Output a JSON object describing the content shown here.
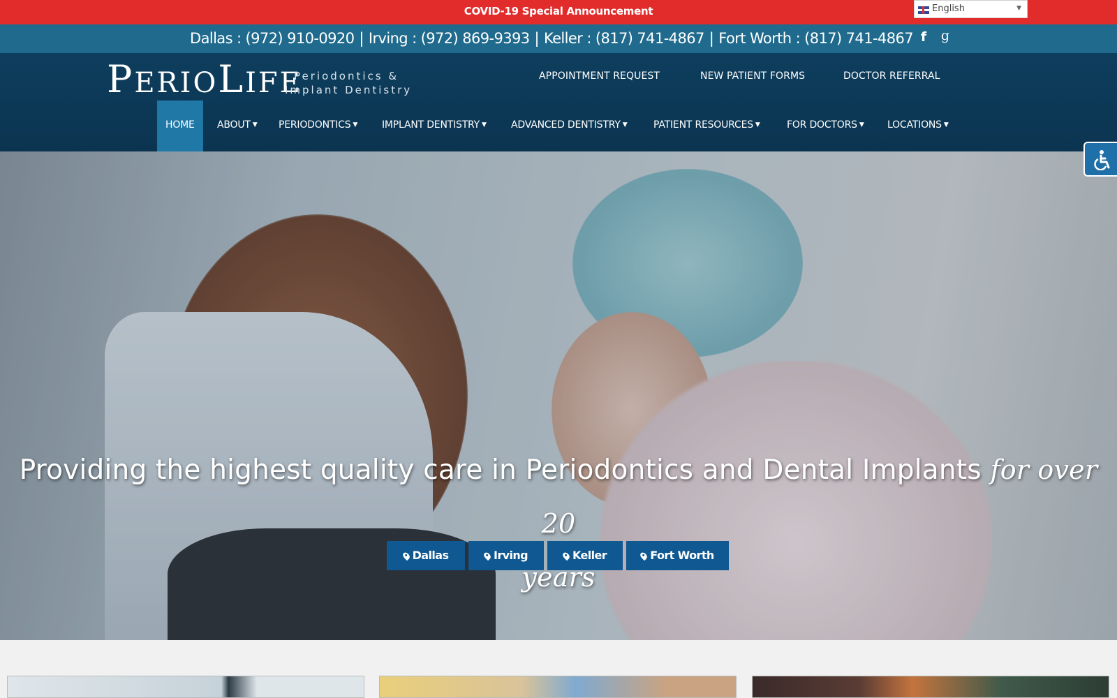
{
  "announcement": {
    "text": "COVID-19 Special Announcement"
  },
  "language": {
    "selected": "English"
  },
  "phones": [
    {
      "text": "Dallas : (972) 910-0920"
    },
    {
      "text": "Irving : (972) 869-9393"
    },
    {
      "text": "Keller : (817) 741-4867"
    },
    {
      "text": "Fort Worth : (817) 741-4867"
    }
  ],
  "phone_separator": "|",
  "social": {
    "facebook": "f",
    "google": "g"
  },
  "logo": {
    "first_big": "P",
    "first_rest": "ERIO",
    "second_big": "L",
    "second_rest": "IFE",
    "tagline_1": "Periodontics &",
    "tagline_2": "Implant Dentistry"
  },
  "top_links": [
    "APPOINTMENT REQUEST",
    "NEW PATIENT FORMS",
    "DOCTOR REFERRAL"
  ],
  "nav": [
    {
      "label": "HOME",
      "active": true,
      "dropdown": false
    },
    {
      "label": "ABOUT",
      "dropdown": true
    },
    {
      "label": "PERIODONTICS",
      "dropdown": true
    },
    {
      "label": "IMPLANT DENTISTRY",
      "dropdown": true
    },
    {
      "label": "ADVANCED DENTISTRY",
      "dropdown": true
    },
    {
      "label": "PATIENT RESOURCES",
      "dropdown": true
    },
    {
      "label": "FOR DOCTORS",
      "dropdown": true
    },
    {
      "label": "LOCATIONS",
      "dropdown": true
    }
  ],
  "hero": {
    "headline": "Providing the highest quality care in Periodontics and Dental Implants",
    "headline_script_1": "for over 20",
    "headline_script_2": "years",
    "buttons": [
      "Dallas",
      "Irving",
      "Keller",
      "Fort Worth"
    ]
  },
  "colors": {
    "announce": "#e22b2b",
    "phonebar": "#1f6a8d",
    "header": "#0e3e5e",
    "nav_active": "#1f78a6",
    "button": "#0f5891"
  }
}
